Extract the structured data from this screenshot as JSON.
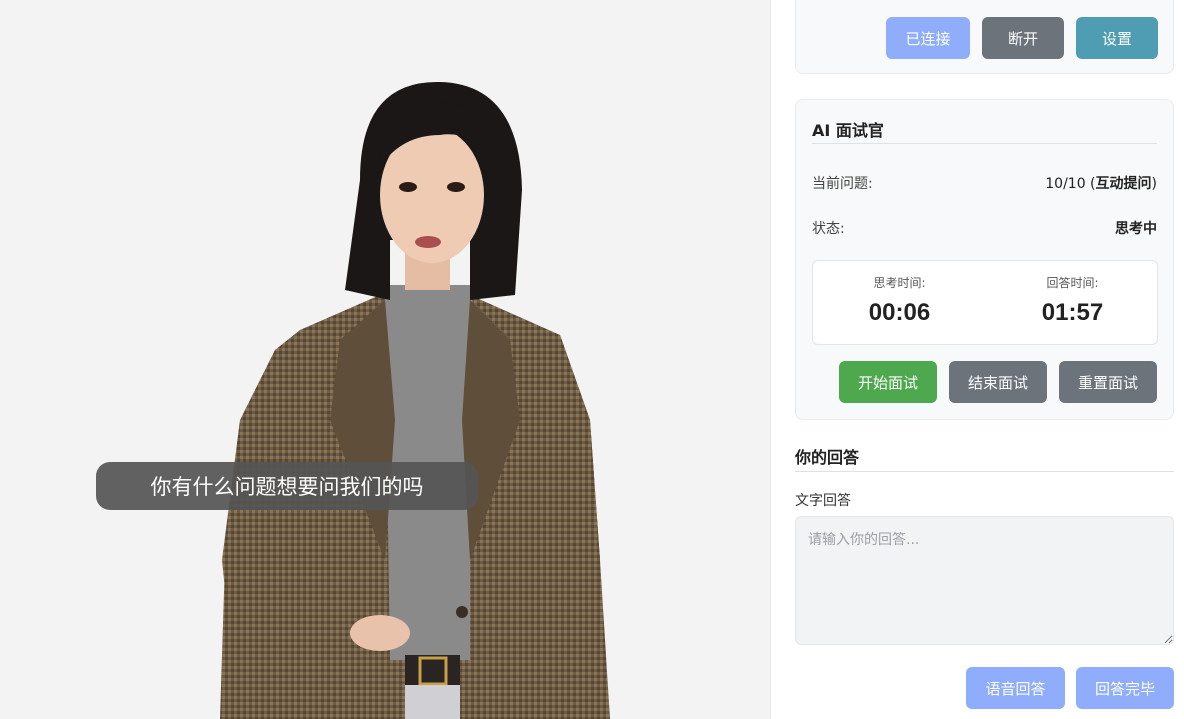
{
  "video": {
    "subtitle": "你有什么问题想要问我们的吗"
  },
  "connection": {
    "connected_label": "已连接",
    "disconnect_label": "断开",
    "settings_label": "设置"
  },
  "interviewer": {
    "title": "AI 面试官",
    "question_label": "当前问题:",
    "question_progress": "10/10 (",
    "question_type": "互动提问",
    "question_close": ")",
    "status_label": "状态:",
    "status_value": "思考中",
    "timers": {
      "think_label": "思考时间:",
      "think_value": "00:06",
      "answer_label": "回答时间:",
      "answer_value": "01:57"
    },
    "start_label": "开始面试",
    "end_label": "结束面试",
    "reset_label": "重置面试"
  },
  "answer": {
    "title": "你的回答",
    "text_label": "文字回答",
    "placeholder": "请输入你的回答...",
    "voice_label": "语音回答",
    "done_label": "回答完毕"
  },
  "colors": {
    "primary_light": "#8fadfa",
    "secondary": "#6c737b",
    "info": "#4f9db2",
    "success": "#4ea84e"
  }
}
